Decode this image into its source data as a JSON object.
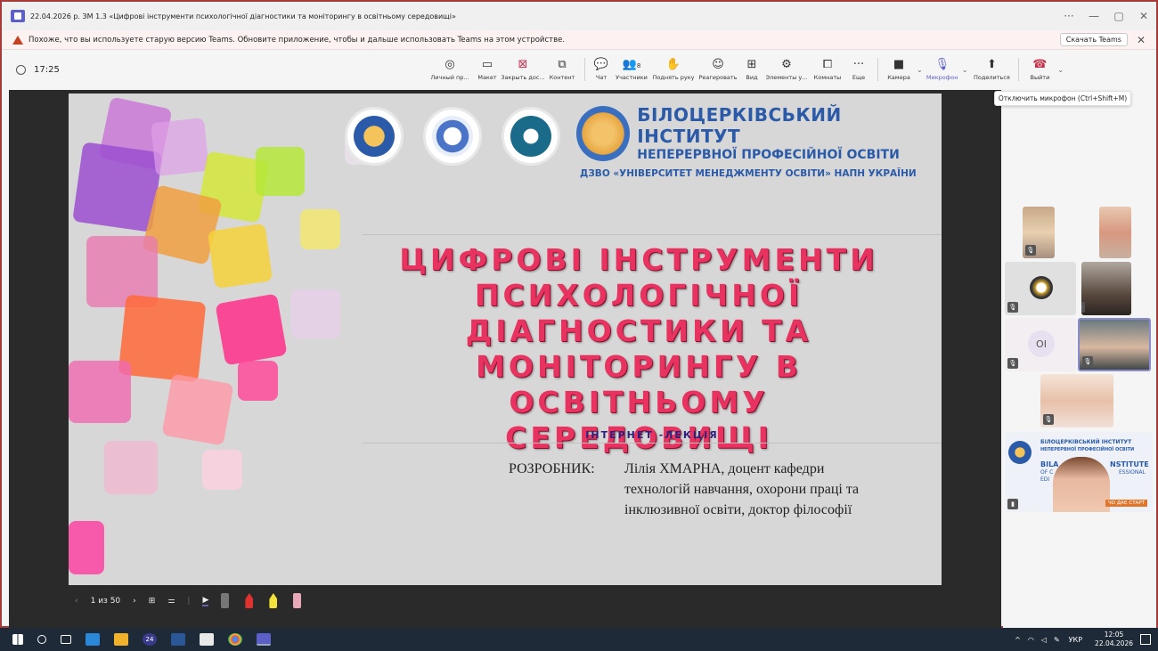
{
  "window": {
    "title": "22.04.2026 р. ЗМ 1.3 «Цифрові інструменти психологічної діагностики та моніторингу в освітньому середовищі»",
    "controls": [
      "···",
      "—",
      "▢",
      "✕"
    ]
  },
  "warning": {
    "message": "Похоже, что вы используете старую версию Teams. Обновите приложение, чтобы и дальше использовать Teams на этом устройстве.",
    "download_label": "Скачать Teams",
    "close": "✕"
  },
  "toolbar": {
    "time": "17:25",
    "items": [
      {
        "label": "Личный пр...",
        "icon": "◎"
      },
      {
        "label": "Макет",
        "icon": "▭"
      },
      {
        "label": "Закрыть дос...",
        "icon": "⊠"
      },
      {
        "label": "Контент",
        "icon": "⧉"
      },
      {
        "label": "Чат",
        "icon": "💬"
      },
      {
        "label": "Участники",
        "icon": "👥"
      },
      {
        "label": "Поднять руку",
        "icon": "✋"
      },
      {
        "label": "Реагировать",
        "icon": "☺"
      },
      {
        "label": "Вид",
        "icon": "⊞"
      },
      {
        "label": "Элементы у...",
        "icon": "⚙"
      },
      {
        "label": "Комнаты",
        "icon": "⧠"
      },
      {
        "label": "Еще",
        "icon": "···"
      },
      {
        "label": "Камера",
        "icon": "■"
      },
      {
        "label": "Микрофон",
        "icon": "🎙"
      },
      {
        "label": "Поделиться",
        "icon": "⬆"
      },
      {
        "label": "Выйти",
        "icon": "☎"
      }
    ],
    "participants_count": "8"
  },
  "tooltip": "Отключить микрофон (Ctrl+Shift+M)",
  "slide": {
    "inst_line1": "БІЛОЦЕРКІВСЬКИЙ ІНСТИТУТ",
    "inst_line2": "НЕПЕРЕРВНОЇ ПРОФЕСІЙНОЇ ОСВІТИ",
    "inst_line3": "ДЗВО «УНІВЕРСИТЕТ МЕНЕДЖМЕНТУ ОСВІТИ» НАПН УКРАЇНИ",
    "title": [
      "ЦИФРОВІ ІНСТРУМЕНТИ",
      "ПСИХОЛОГІЧНОЇ",
      "ДІАГНОСТИКИ ТА",
      "МОНІТОРИНГУ В",
      "ОСВІТНЬОМУ СЕРЕДОВИЩІ"
    ],
    "subtitle": "ІНТЕРНЕТ -ЛЕКЦІЯ",
    "author_label": "РОЗРОБНИК:",
    "author_line1": "Лілія ХМАРНА, доцент кафедри",
    "author_line2": "технологій навчання, охорони праці та",
    "author_line3": "інклюзивної освіти, доктор філософії"
  },
  "presenter": {
    "prev": "‹",
    "page": "1 из 50",
    "next": "›",
    "grid": "⊞",
    "settings": "⚌",
    "pointer": "▶"
  },
  "participants": [
    {
      "initials": "OI"
    }
  ],
  "shared_banner": {
    "line1": "БІЛОЦЕРКІВСЬКИЙ ІНСТИТУТ",
    "line2": "НЕПЕРЕРВНОЇ ПРОФЕСІЙНОЇ ОСВІТИ",
    "line3": "BILA",
    "line4": "NSTITUTE",
    "line5": "OF C",
    "line6": "ESSIONAL",
    "line7": "EDI",
    "line8": "ЧО ДАЄ СТАРТ"
  },
  "taskbar": {
    "lang": "УКР",
    "time": "12:05",
    "date": "22.04.2026",
    "badge": "24"
  },
  "colors": {
    "title_red": "#e8325f",
    "brand_blue": "#2a5aa8",
    "subtitle": "#2e1f7a",
    "leave": "#c4314b",
    "accent": "#5b5fc7"
  }
}
